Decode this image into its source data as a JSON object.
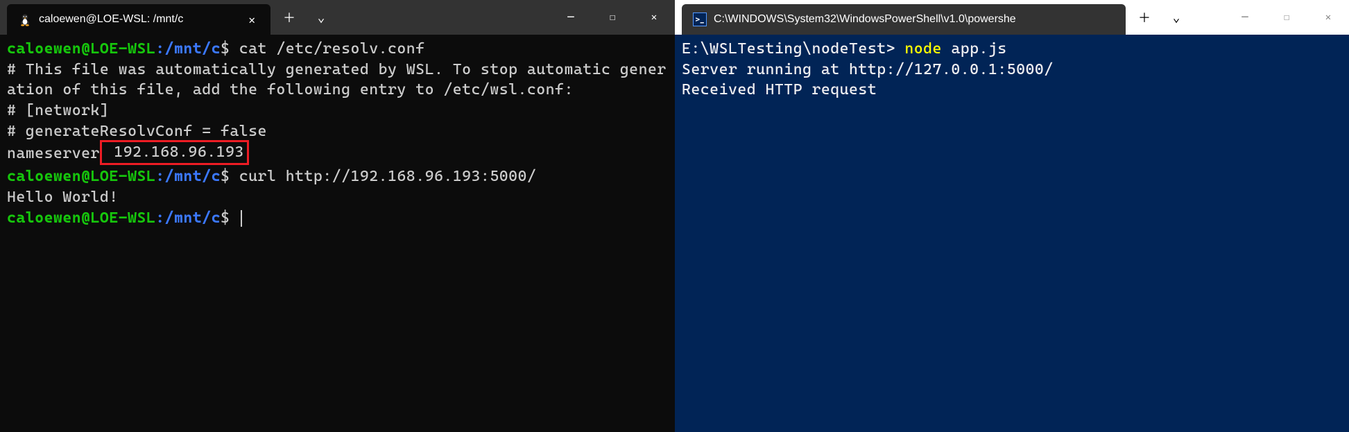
{
  "leftWindow": {
    "tab": {
      "title": "caloewen@LOE-WSL: /mnt/c",
      "iconName": "tux-icon"
    },
    "terminal": {
      "prompt": {
        "user": "caloewen@LOE-WSL",
        "separator": ":",
        "path": "/mnt/c",
        "symbol": "$"
      },
      "lines": [
        {
          "type": "cmd",
          "command": "cat /etc/resolv.conf"
        },
        {
          "type": "output",
          "text": "# This file was automatically generated by WSL. To stop automatic generation of this file, add the following entry to /etc/wsl.conf:"
        },
        {
          "type": "output",
          "text": "# [network]"
        },
        {
          "type": "output",
          "text": "# generateResolvConf = false"
        },
        {
          "type": "output-highlight",
          "prefix": "nameserver",
          "highlighted": " 192.168.96.193"
        },
        {
          "type": "cmd",
          "command": "curl http://192.168.96.193:5000/"
        },
        {
          "type": "output",
          "text": "Hello World!"
        },
        {
          "type": "cmd-cursor",
          "command": ""
        }
      ]
    }
  },
  "rightWindow": {
    "tab": {
      "title": "C:\\WINDOWS\\System32\\WindowsPowerShell\\v1.0\\powershe",
      "iconName": "powershell-icon"
    },
    "terminal": {
      "promptText": "E:\\WSLTesting\\nodeTest>",
      "cmdName": "node",
      "cmdArg": "app.js",
      "output1": "Server running at http://127.0.0.1:5000/",
      "output2": "Received HTTP request"
    }
  },
  "icons": {
    "plus": "＋",
    "chevronDown": "⌄",
    "close": "✕",
    "minimize": "─",
    "maximize": "☐",
    "psSymbol": ">_"
  }
}
